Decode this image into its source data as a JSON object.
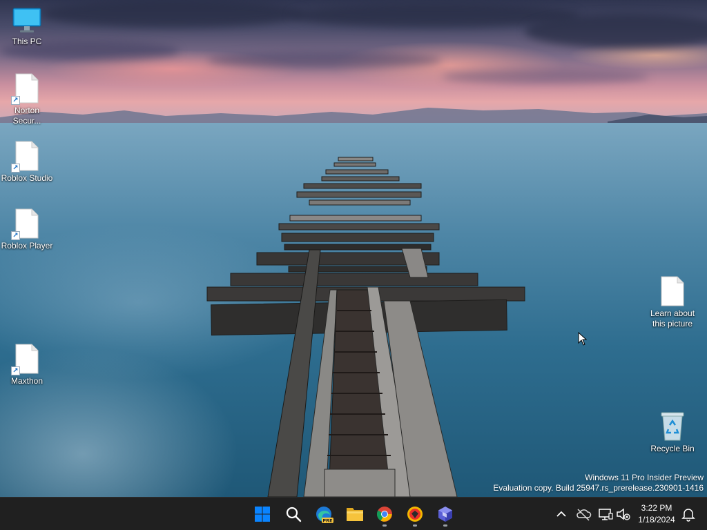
{
  "desktop": {
    "icons": [
      {
        "label": "This PC",
        "icon": "this-pc-icon"
      },
      {
        "label": "Norton Secur...",
        "icon": "file-shortcut-icon"
      },
      {
        "label": "Roblox Studio",
        "icon": "file-shortcut-icon"
      },
      {
        "label": "Roblox Player",
        "icon": "file-shortcut-icon"
      },
      {
        "label": "Maxthon",
        "icon": "file-shortcut-icon"
      },
      {
        "label": "Learn about this picture",
        "icon": "file-icon"
      },
      {
        "label": "Recycle Bin",
        "icon": "recycle-bin-icon"
      }
    ]
  },
  "watermark": {
    "line1": "Windows 11 Pro Insider Preview",
    "line2": "Evaluation copy. Build 25947.rs_prerelease.230901-1416"
  },
  "taskbar": {
    "apps": [
      {
        "name": "start",
        "icon": "windows-start-icon"
      },
      {
        "name": "search",
        "icon": "search-icon"
      },
      {
        "name": "edge-canary",
        "icon": "edge-pre-icon",
        "badge": "PRE"
      },
      {
        "name": "file-explorer",
        "icon": "folder-icon"
      },
      {
        "name": "chrome",
        "icon": "chrome-icon",
        "running": true
      },
      {
        "name": "yandex",
        "icon": "yandex-browser-icon",
        "running": true
      },
      {
        "name": "app-cube",
        "icon": "cube-app-icon",
        "running": true
      }
    ],
    "tray": {
      "icons": [
        "chevron-up-icon",
        "onedrive-offline-icon",
        "network-icon",
        "volume-muted-icon",
        "notification-bell-icon"
      ]
    },
    "clock": {
      "time": "3:22 PM",
      "date": "1/18/2024"
    }
  },
  "colors": {
    "taskbar_bg": "#202020",
    "start_blue": "#0a84ff",
    "folder_yellow": "#f6c33c"
  }
}
